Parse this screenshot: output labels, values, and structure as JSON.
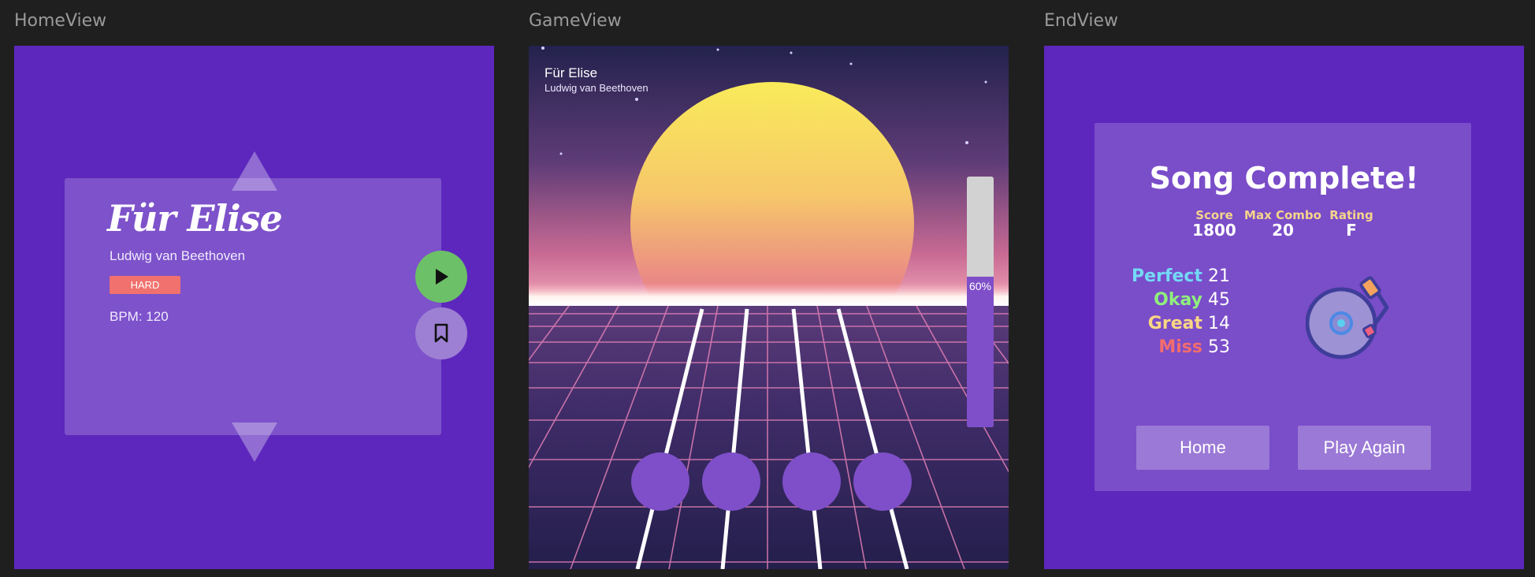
{
  "views": {
    "home_label": "HomeView",
    "game_label": "GameView",
    "end_label": "EndView"
  },
  "home": {
    "song_title": "Für Elise",
    "artist": "Ludwig van Beethoven",
    "difficulty": "HARD",
    "bpm": "BPM: 120",
    "icons": [
      "triangle-up-icon",
      "triangle-down-icon",
      "play-icon",
      "bookmark-icon"
    ]
  },
  "game": {
    "song_title": "Für Elise",
    "artist": "Ludwig van Beethoven",
    "progress_label": "60%",
    "progress_value": 0.6
  },
  "end": {
    "title": "Song Complete!",
    "stats": [
      {
        "label": "Score",
        "value": "1800"
      },
      {
        "label": "Max Combo",
        "value": "20"
      },
      {
        "label": "Rating",
        "value": "F"
      }
    ],
    "judgements": [
      {
        "label": "Perfect",
        "value": "21",
        "color": "#74d9f5"
      },
      {
        "label": "Okay",
        "value": "45",
        "color": "#8ff07c"
      },
      {
        "label": "Great",
        "value": "14",
        "color": "#f9d684"
      },
      {
        "label": "Miss",
        "value": "53",
        "color": "#f26d6d"
      }
    ],
    "home_button": "Home",
    "play_again_button": "Play Again",
    "icons": [
      "turntable-icon"
    ]
  },
  "colors": {
    "panel": "#5d27bd",
    "play_button": "#6cc067",
    "badge": "#f0716d",
    "sun_top": "#f9eb5a",
    "grid": "#e07fb4"
  }
}
